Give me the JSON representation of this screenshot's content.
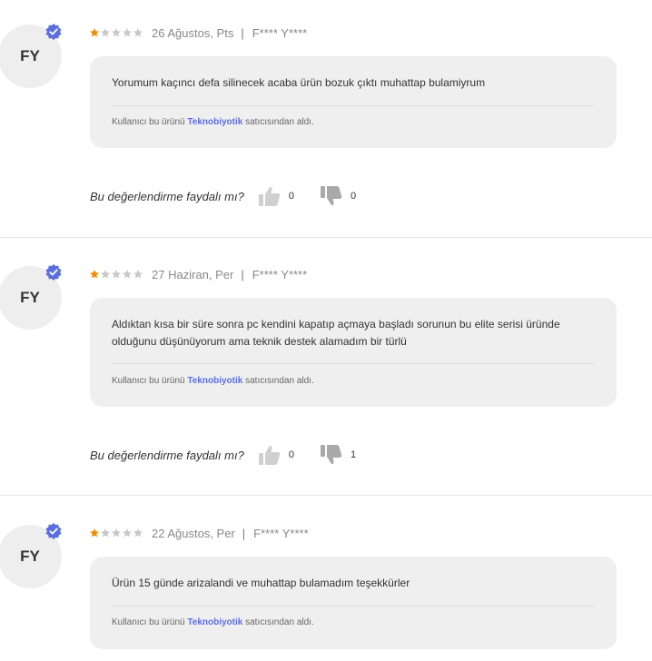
{
  "helpful_question": "Bu değerlendirme faydalı mı?",
  "seller_prefix": "Kullanıcı bu ürünü",
  "seller_suffix": "satıcısından aldı.",
  "colors": {
    "star_filled": "#f28b00",
    "star_empty": "#c8c8c8",
    "badge": "#5b6ee1",
    "seller_link": "#5b6ee1"
  },
  "reviews": [
    {
      "initials": "FY",
      "rating": 1,
      "date": "26 Ağustos, Pts",
      "separator": "|",
      "user": "F**** Y****",
      "comment": "Yorumum kaçıncı defa silinecek acaba ürün bozuk çıktı muhattap bulamiyrum",
      "seller": "Teknobiyotik",
      "likes": "0",
      "dislikes": "0"
    },
    {
      "initials": "FY",
      "rating": 1,
      "date": "27 Haziran, Per",
      "separator": "|",
      "user": "F**** Y****",
      "comment": "Aldıktan kısa bir süre sonra pc kendini kapatıp açmaya başladı sorunun bu elite serisi üründe olduğunu düşünüyorum ama teknik destek alamadım bir türlü",
      "seller": "Teknobiyotik",
      "likes": "0",
      "dislikes": "1"
    },
    {
      "initials": "FY",
      "rating": 1,
      "date": "22 Ağustos, Per",
      "separator": "|",
      "user": "F**** Y****",
      "comment": "Ürün 15 günde arizalandi ve muhattap bulamadım teşekkürler",
      "seller": "Teknobiyotik",
      "likes": "",
      "dislikes": ""
    }
  ]
}
